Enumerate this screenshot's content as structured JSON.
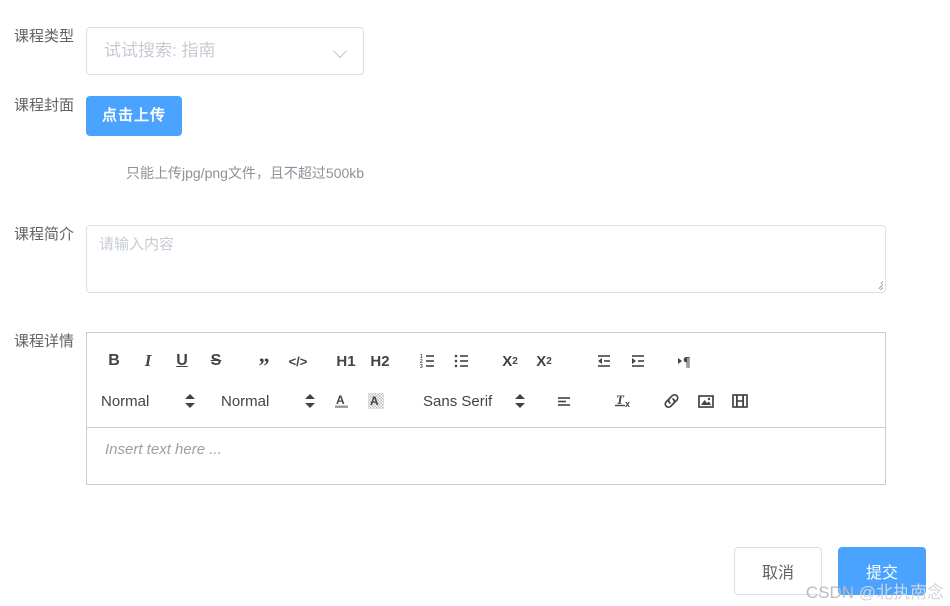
{
  "form": {
    "fields": [
      {
        "label": "课程类型",
        "type": "select",
        "placeholder": "试试搜索: 指南",
        "value": "",
        "icon": "chevron-down-icon"
      },
      {
        "label": "课程封面",
        "type": "upload",
        "button_label": "点击上传",
        "tip": "只能上传jpg/png文件，且不超过500kb"
      },
      {
        "label": "课程简介",
        "type": "textarea",
        "placeholder": "请输入内容",
        "value": ""
      },
      {
        "label": "课程详情",
        "type": "richtext",
        "placeholder": "Insert text here ..."
      }
    ]
  },
  "editor": {
    "toolbar_row1": [
      {
        "name": "bold-icon",
        "label": "B"
      },
      {
        "name": "italic-icon",
        "label": "I"
      },
      {
        "name": "underline-icon",
        "label": "U"
      },
      {
        "name": "strike-icon",
        "label": "S"
      },
      {
        "name": "blockquote-icon",
        "label": "”"
      },
      {
        "name": "code-block-icon",
        "label": "</>"
      },
      {
        "name": "header-1-icon",
        "label": "H1"
      },
      {
        "name": "header-2-icon",
        "label": "H2"
      },
      {
        "name": "ordered-list-icon",
        "label": ""
      },
      {
        "name": "bullet-list-icon",
        "label": ""
      },
      {
        "name": "subscript-icon",
        "label": "X2"
      },
      {
        "name": "superscript-icon",
        "label": "X2"
      },
      {
        "name": "outdent-icon",
        "label": ""
      },
      {
        "name": "indent-icon",
        "label": ""
      },
      {
        "name": "text-direction-icon",
        "label": "¶"
      }
    ],
    "toolbar_row2": {
      "size_label": "Normal",
      "header_label": "Normal",
      "color_icon": "text-color-icon",
      "background_icon": "background-color-icon",
      "font_label": "Sans Serif",
      "align_icon": "align-left-icon",
      "clean_icon": "clear-format-icon",
      "link_icon": "link-icon",
      "image_icon": "image-icon",
      "video_icon": "video-icon"
    }
  },
  "footer": {
    "cancel_label": "取消",
    "submit_label": "提交"
  },
  "watermark": {
    "brand": "CSDN ",
    "user": "@北执南念"
  },
  "colors": {
    "primary": "#4aa3ff",
    "border": "#dcdfe6",
    "text": "#606266",
    "placeholder": "#c6cbd4"
  }
}
